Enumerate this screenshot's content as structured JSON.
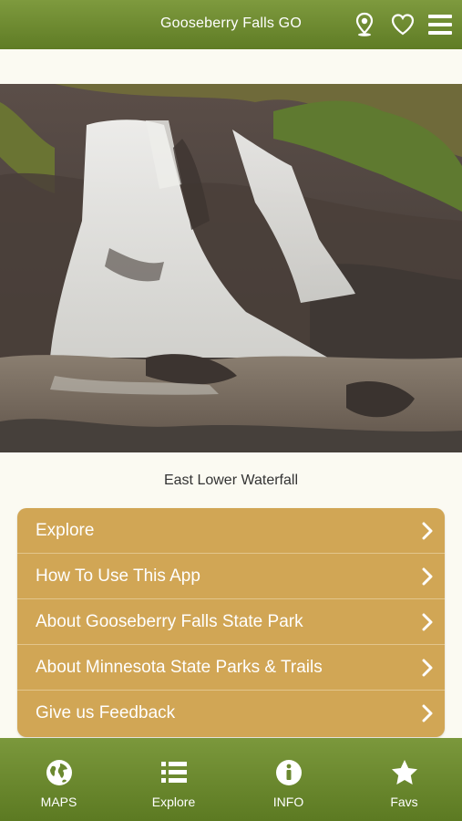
{
  "header": {
    "title": "Gooseberry Falls GO",
    "icons": [
      "location-pin-icon",
      "heart-icon",
      "hamburger-menu-icon"
    ]
  },
  "hero": {
    "caption": "East Lower Waterfall"
  },
  "menu": {
    "items": [
      {
        "label": "Explore"
      },
      {
        "label": "How To Use This App"
      },
      {
        "label": "About Gooseberry Falls State Park"
      },
      {
        "label": "About Minnesota State Parks & Trails"
      },
      {
        "label": "Give us Feedback"
      }
    ]
  },
  "tabbar": {
    "tabs": [
      {
        "label": "MAPS",
        "icon": "globe-icon"
      },
      {
        "label": "Explore",
        "icon": "list-icon"
      },
      {
        "label": "INFO",
        "icon": "info-icon"
      },
      {
        "label": "Favs",
        "icon": "star-icon"
      }
    ]
  },
  "colors": {
    "header_green": "#6d8a31",
    "menu_gold": "#d1a655",
    "background": "#fbfaf2"
  }
}
